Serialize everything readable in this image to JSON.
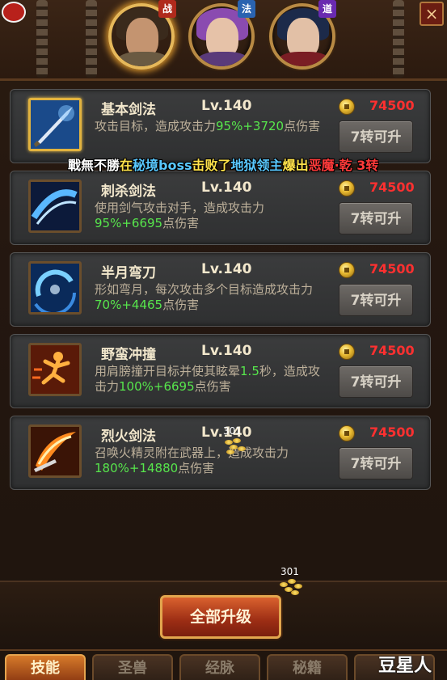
{
  "header": {
    "heroes": [
      {
        "class_tag": "战",
        "tag_color": "#b02a1c",
        "active": true
      },
      {
        "class_tag": "法",
        "tag_color": "#2a63b0",
        "active": false
      },
      {
        "class_tag": "道",
        "tag_color": "#6a2ab0",
        "active": false
      }
    ],
    "close_label": "×"
  },
  "broadcast": {
    "parts": [
      {
        "text": "戰無不勝",
        "color": "white"
      },
      {
        "text": "在",
        "color": "yellow"
      },
      {
        "text": "秘境boss",
        "color": "cyan"
      },
      {
        "text": "击败了",
        "color": "yellow"
      },
      {
        "text": "地狱领主",
        "color": "cyan"
      },
      {
        "text": "爆出",
        "color": "yellow"
      },
      {
        "text": "恶魔·乾 3转",
        "color": "red"
      }
    ]
  },
  "skills": [
    {
      "name": "基本剑法",
      "level": "Lv.140",
      "desc": [
        {
          "t": "攻击目标，造成攻击力",
          "g": false
        },
        {
          "t": "95%+3720",
          "g": true
        },
        {
          "t": "点伤害",
          "g": false
        }
      ],
      "price": "74500",
      "button": "7转可升",
      "icon": "basic-sword-skill-icon",
      "selected": true
    },
    {
      "name": "刺杀剑法",
      "level": "Lv.140",
      "desc": [
        {
          "t": "使用剑气攻击对手，造成攻击力",
          "g": false
        },
        {
          "t": "95%+6695",
          "g": true
        },
        {
          "t": "点伤害",
          "g": false
        }
      ],
      "price": "74500",
      "button": "7转可升",
      "icon": "assassinate-sword-skill-icon",
      "selected": false
    },
    {
      "name": "半月弯刀",
      "level": "Lv.140",
      "desc": [
        {
          "t": "形如弯月，每次攻击多个目标造成攻击力",
          "g": false
        },
        {
          "t": "70%+4465",
          "g": true
        },
        {
          "t": "点伤害",
          "g": false
        }
      ],
      "price": "74500",
      "button": "7转可升",
      "icon": "half-moon-blade-skill-icon",
      "selected": false
    },
    {
      "name": "野蛮冲撞",
      "level": "Lv.140",
      "desc": [
        {
          "t": "用肩膀撞开目标并使其眩晕",
          "g": false
        },
        {
          "t": "1.5",
          "g": true
        },
        {
          "t": "秒，造成攻击力",
          "g": false
        },
        {
          "t": "100%+6695",
          "g": true
        },
        {
          "t": "点伤害",
          "g": false
        }
      ],
      "price": "74500",
      "button": "7转可升",
      "icon": "savage-charge-skill-icon",
      "selected": false
    },
    {
      "name": "烈火剑法",
      "level": "Lv.140",
      "desc": [
        {
          "t": "召唤火精灵附在武器上，造成攻击力",
          "g": false
        },
        {
          "t": "180%+14880",
          "g": true
        },
        {
          "t": "点伤害",
          "g": false
        }
      ],
      "price": "74500",
      "button": "7转可升",
      "icon": "blazing-sword-skill-icon",
      "selected": false
    }
  ],
  "floating": {
    "gold_top": "301",
    "gold_bottom": "301"
  },
  "footer": {
    "upgrade_all": "全部升级"
  },
  "tabs": [
    {
      "label": "技能",
      "active": true
    },
    {
      "label": "圣兽",
      "active": false
    },
    {
      "label": "经脉",
      "active": false
    },
    {
      "label": "秘籍",
      "active": false
    },
    {
      "label": "",
      "active": false
    }
  ],
  "watermark": "豆星人"
}
